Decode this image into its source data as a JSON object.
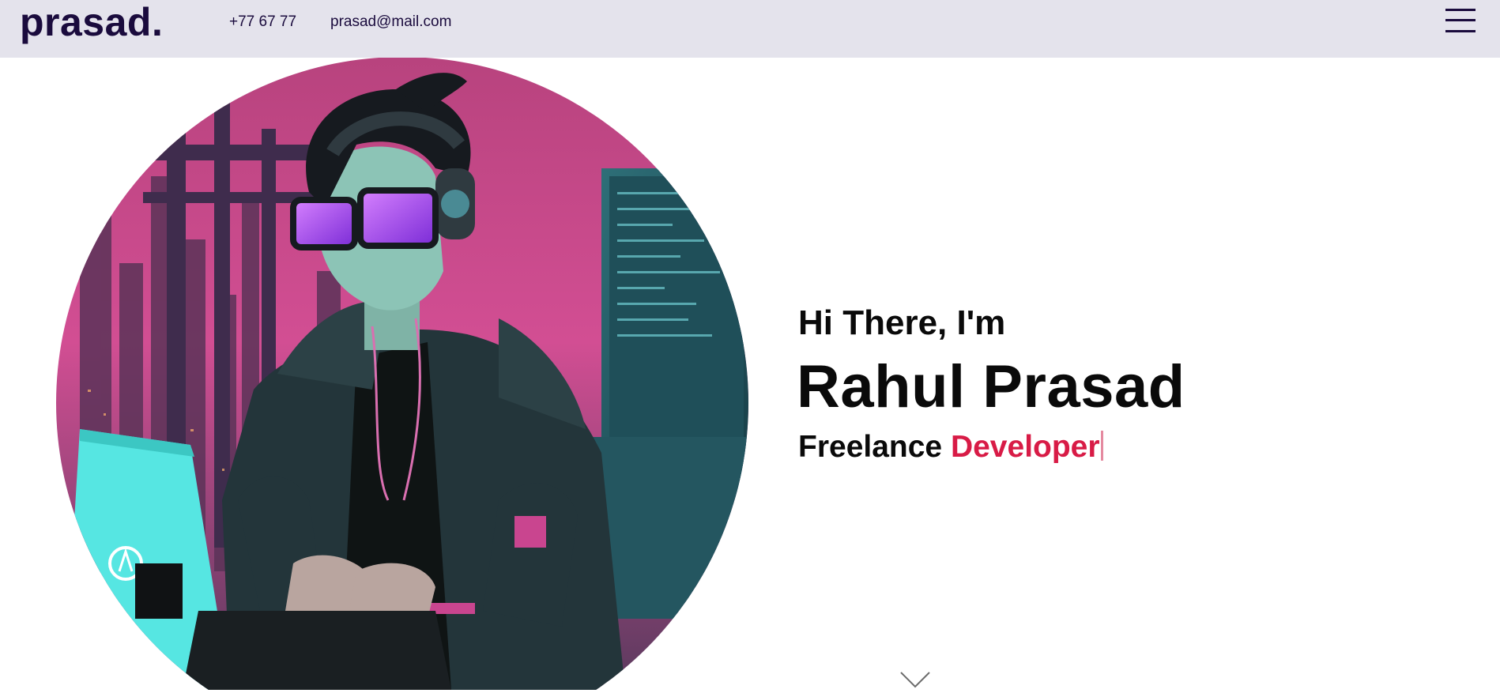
{
  "header": {
    "logo": "prasad.",
    "phone": "+77 67 77",
    "email": "prasad@mail.com",
    "menu_icon": "hamburger-menu-icon"
  },
  "hero": {
    "image_alt": "cyberpunk hacker illustration",
    "greeting": "Hi There, I'm",
    "name": "Rahul Prasad",
    "role_prefix": "Freelance",
    "role_word": "Developer",
    "scroll_icon": "chevron-down-icon"
  },
  "colors": {
    "header_bg": "#e4e3ec",
    "brand": "#1a0b3d",
    "accent": "#d81b46",
    "text": "#0a0a0a"
  }
}
